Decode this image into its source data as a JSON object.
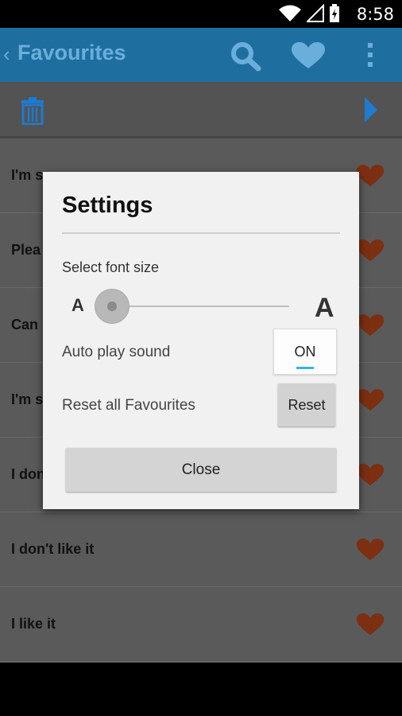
{
  "status_bar": {
    "time": "8:58",
    "icons": [
      "wifi-icon",
      "signal-icon",
      "battery-charging-icon"
    ]
  },
  "action_bar": {
    "back_glyph": "‹",
    "title": "Favourites",
    "icons": [
      "search-icon",
      "heart-icon",
      "overflow-menu-icon"
    ],
    "color": "#1e6f9f"
  },
  "toolbar": {
    "icons": [
      "trash-icon",
      "play-icon"
    ],
    "accent": "#1e7bd0"
  },
  "list": {
    "items": [
      {
        "text": "I'm s"
      },
      {
        "text": "Plea"
      },
      {
        "text": "Can"
      },
      {
        "text": "I'm s"
      },
      {
        "text": "I don"
      },
      {
        "text": "I don't like it"
      },
      {
        "text": "I like it"
      }
    ]
  },
  "dialog": {
    "title": "Settings",
    "font_size_label": "Select font size",
    "font_small_glyph": "A",
    "font_large_glyph": "A",
    "font_size_level": 0,
    "auto_play_label": "Auto play sound",
    "auto_play_value": "ON",
    "reset_label": "Reset all Favourites",
    "reset_button": "Reset",
    "close_button": "Close",
    "toggle_accent": "#33b5e5"
  }
}
